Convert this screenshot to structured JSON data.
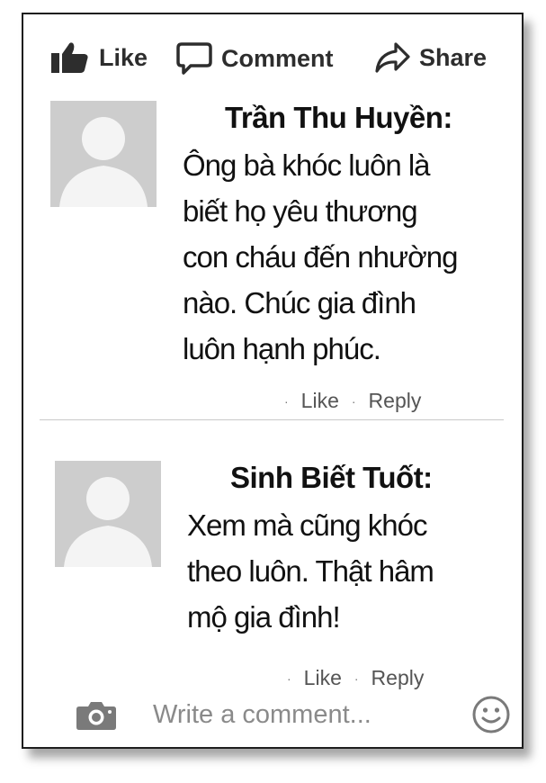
{
  "actions": {
    "like_label": "Like",
    "comment_label": "Comment",
    "share_label": "Share"
  },
  "comments": [
    {
      "author": "Trần Thu Huyền:",
      "lines": [
        "Ông bà khóc luôn là",
        "biết họ yêu thương",
        "con cháu đến nhường",
        "nào. Chúc gia đình",
        "luôn hạnh phúc."
      ],
      "like_label": "Like",
      "reply_label": "Reply"
    },
    {
      "author": "Sinh Biết Tuốt:",
      "lines": [
        "Xem mà cũng khóc",
        "theo luôn. Thật hâm",
        "mộ gia đình!"
      ],
      "like_label": "Like",
      "reply_label": "Reply"
    }
  ],
  "composer": {
    "placeholder": "Write a comment...",
    "camera_icon": "camera-icon",
    "emoji_icon": "smiley-icon"
  }
}
